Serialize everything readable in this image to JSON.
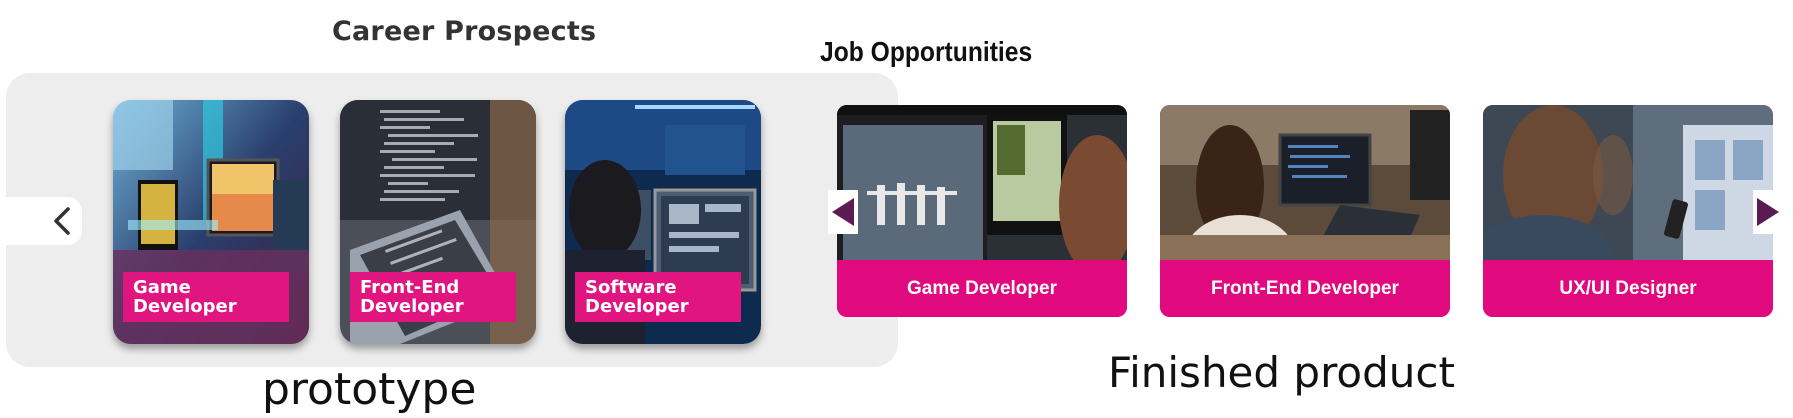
{
  "prototype": {
    "title": "Career Prospects",
    "caption": "prototype",
    "cards": [
      {
        "label": "Game\nDeveloper"
      },
      {
        "label": "Front-End\nDeveloper"
      },
      {
        "label": "Software\nDeveloper"
      }
    ],
    "prev_icon": "chevron-left-icon"
  },
  "finished": {
    "title": "Job Opportunities",
    "caption": "Finished product",
    "cards": [
      {
        "label": "Game Developer"
      },
      {
        "label": "Front-End Developer"
      },
      {
        "label": "UX/UI Designer"
      }
    ],
    "prev_icon": "triangle-left-icon",
    "next_icon": "triangle-right-icon"
  },
  "colors": {
    "accent_pink": "#e0097e",
    "arrow_purple": "#5a1a52",
    "panel_gray": "#ededed"
  }
}
